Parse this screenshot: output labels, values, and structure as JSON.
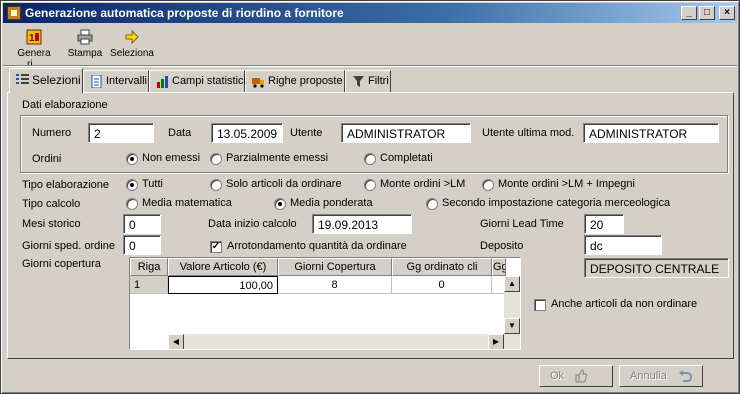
{
  "window": {
    "title": "Generazione automatica proposte di riordino a fornitore",
    "controls": [
      "_",
      "□",
      "×"
    ]
  },
  "toolbar": {
    "genera_label": "Genera ri...",
    "stampa_label": "Stampa",
    "seleziona_label": "Seleziona"
  },
  "tabs": [
    {
      "label": "Selezioni",
      "active": true
    },
    {
      "label": "Intervalli"
    },
    {
      "label": "Campi statistici"
    },
    {
      "label": "Righe proposte"
    },
    {
      "label": "Filtri"
    }
  ],
  "dati_elaborazione": {
    "heading": "Dati elaborazione",
    "numero_label": "Numero",
    "numero_value": "2",
    "data_label": "Data",
    "data_value": "13.05.2009",
    "utente_label": "Utente",
    "utente_value": "ADMINISTRATOR",
    "utente_mod_label": "Utente ultima mod.",
    "utente_mod_value": "ADMINISTRATOR",
    "ordini_label": "Ordini",
    "ordini_options": [
      "Non emessi",
      "Parzialmente emessi",
      "Completati"
    ],
    "ordini_selected": 0
  },
  "tipo_elaborazione": {
    "label": "Tipo elaborazione",
    "options": [
      "Tutti",
      "Solo articoli da ordinare",
      "Monte ordini >LM",
      "Monte ordini >LM + Impegni"
    ],
    "selected": 0
  },
  "tipo_calcolo": {
    "label": "Tipo calcolo",
    "options": [
      "Media matematica",
      "Media ponderata",
      "Secondo impostazione categoria merceologica"
    ],
    "selected": 1
  },
  "params": {
    "mesi_storico_label": "Mesi storico",
    "mesi_storico_value": "0",
    "data_inizio_label": "Data inizio calcolo",
    "data_inizio_value": "19.09.2013",
    "lead_time_label": "Giorni Lead Time",
    "lead_time_value": "20",
    "sped_ordine_label": "Giorni sped. ordine",
    "sped_ordine_value": "0",
    "arrotondamento_label": "Arrotondamento quantità da ordinare",
    "arrotondamento_checked": true,
    "deposito_label": "Deposito",
    "deposito_value": "dc",
    "deposito_desc": "DEPOSITO CENTRALE",
    "giorni_copertura_label": "Giorni copertura",
    "anche_articoli_label": "Anche articoli da non ordinare",
    "anche_articoli_checked": false
  },
  "grid": {
    "columns": [
      "Riga",
      "Valore Articolo (€)",
      "Giorni Copertura",
      "Gg ordinato cli",
      "Gg c"
    ],
    "rows": [
      [
        "1",
        "100,00",
        "8",
        "0",
        ""
      ]
    ]
  },
  "footer": {
    "ok_label": "Ok",
    "annulla_label": "Annulla"
  }
}
